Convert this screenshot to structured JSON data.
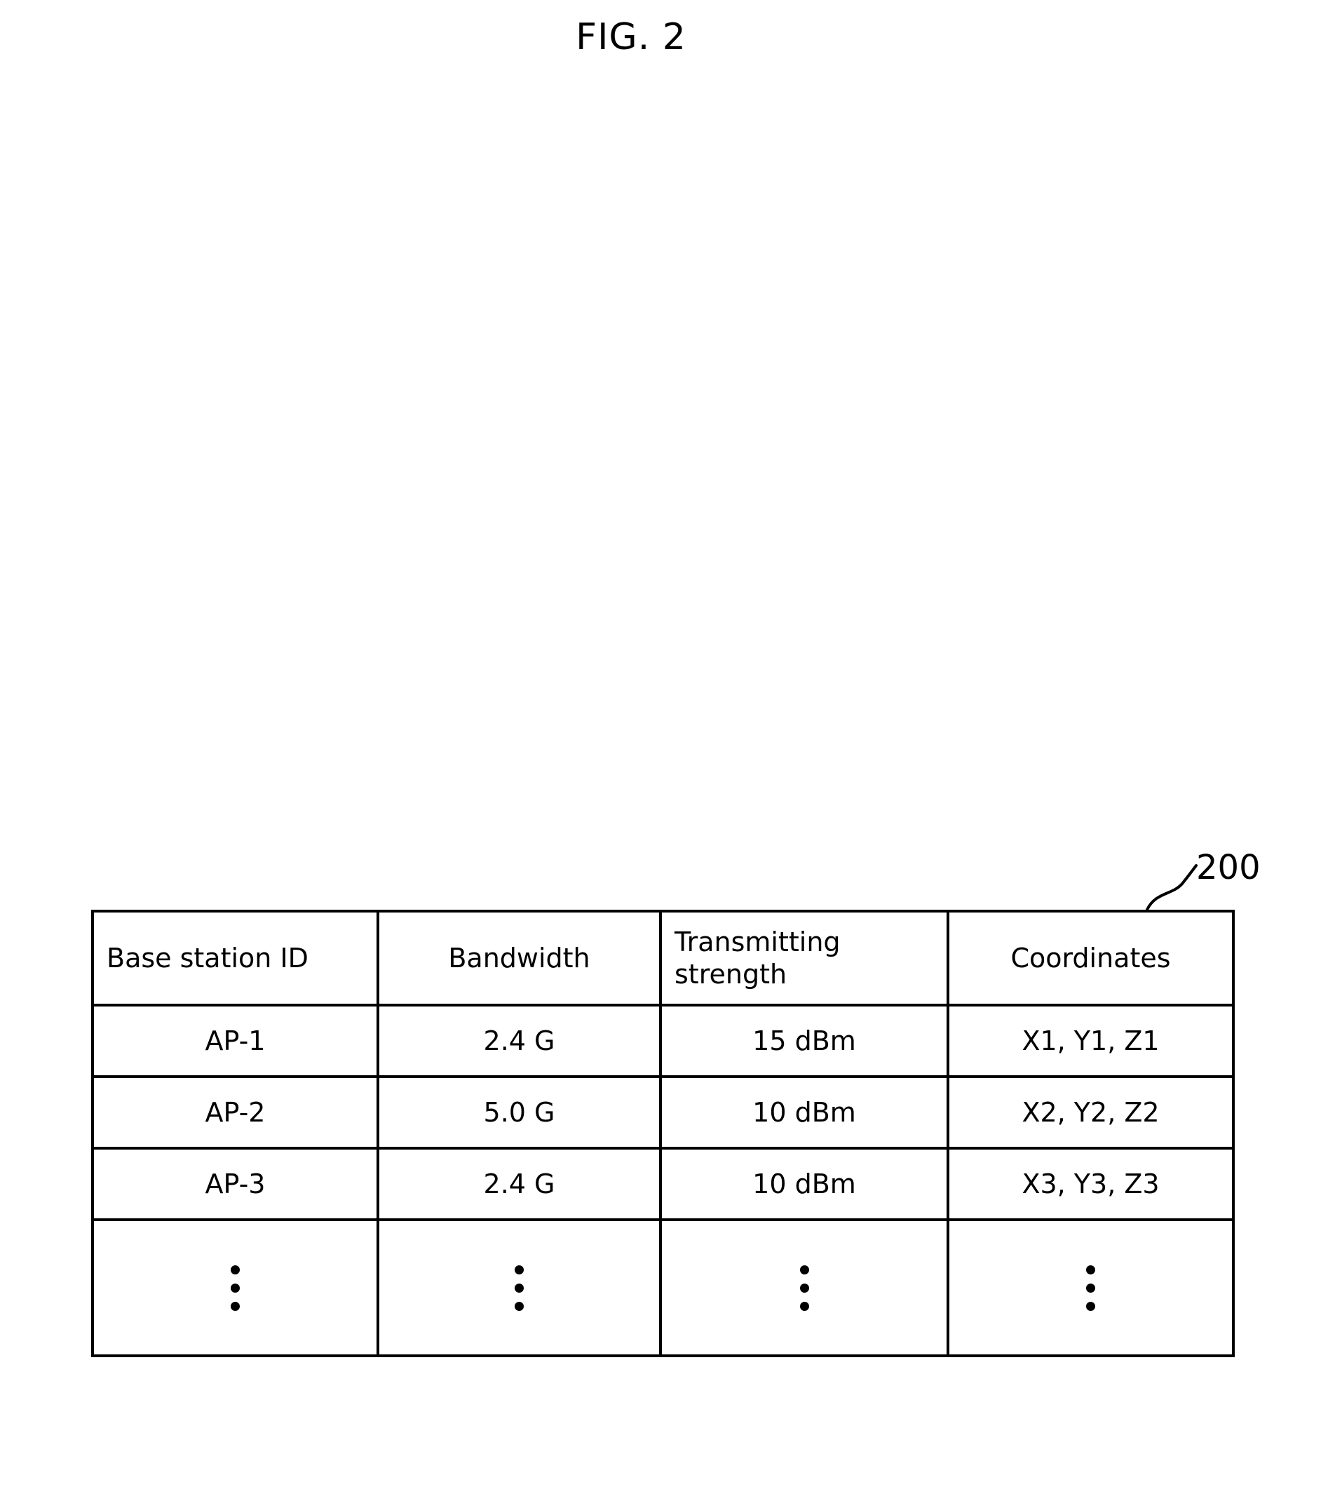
{
  "figure": {
    "title": "FIG. 2",
    "reference_numeral": "200"
  },
  "table": {
    "headers": [
      "Base station ID",
      "Bandwidth",
      "Transmitting strength",
      "Coordinates"
    ],
    "rows": [
      [
        "AP-1",
        "2.4 G",
        "15 dBm",
        "X1, Y1, Z1"
      ],
      [
        "AP-2",
        "5.0 G",
        "10 dBm",
        "X2, Y2, Z2"
      ],
      [
        "AP-3",
        "2.4 G",
        "10 dBm",
        "X3, Y3, Z3"
      ]
    ],
    "continuation_row": {
      "symbol": "vertical-ellipsis",
      "columns": 4
    }
  },
  "colors": {
    "line": "#000000",
    "background": "#ffffff",
    "text": "#000000"
  }
}
